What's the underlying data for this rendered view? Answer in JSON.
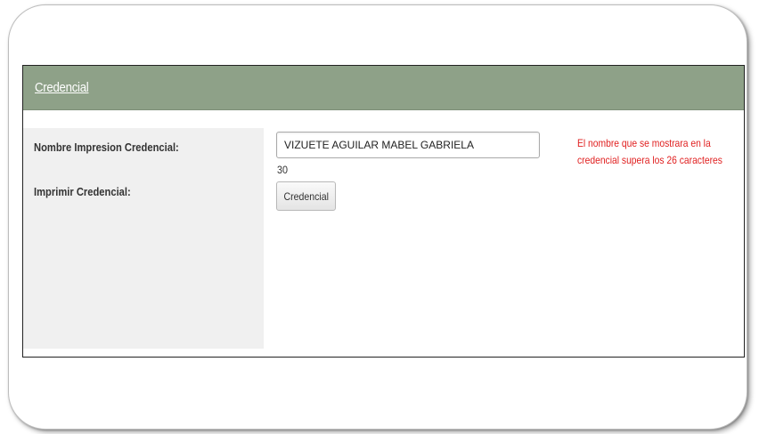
{
  "panel": {
    "title": "Credencial"
  },
  "form": {
    "name_label": "Nombre Impresion Credencial:",
    "name_value": "VIZUETE AGUILAR MABEL GABRIELA",
    "char_count": "30",
    "print_label": "Imprimir Credencial:",
    "print_button": "Credencial",
    "warning": "El nombre que se mostrara en la credencial supera los 26 caracteres"
  },
  "colors": {
    "header": "#8ea188",
    "label_bg": "#f0f0f0",
    "warning": "#e02020"
  }
}
